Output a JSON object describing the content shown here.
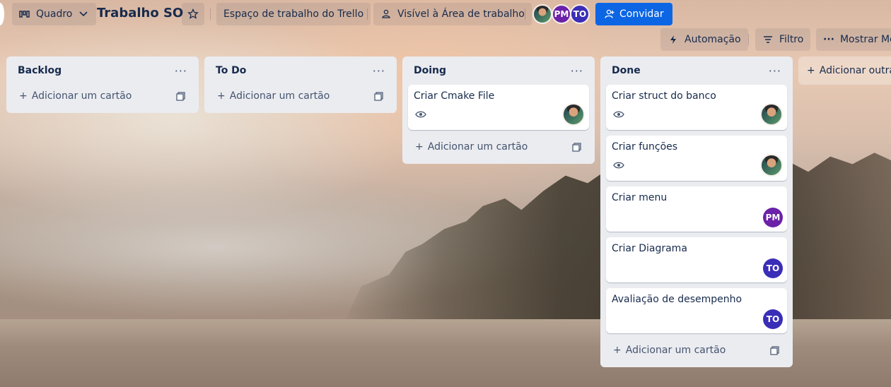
{
  "header": {
    "view_label": "Quadro",
    "board_title": "Trabalho SO",
    "workspace_label": "Espaço de trabalho do Trello",
    "visibility_label": "Visível à Área de trabalho",
    "invite_label": "Convidar",
    "members": [
      {
        "initials": "",
        "color": "photo"
      },
      {
        "initials": "PM",
        "color": "#6b21a8"
      },
      {
        "initials": "TO",
        "color": "#3a2db7"
      }
    ]
  },
  "toolbar": {
    "automation_label": "Automação",
    "filter_label": "Filtro",
    "show_menu_label": "Mostrar Me"
  },
  "lists": [
    {
      "title": "Backlog",
      "cards": [],
      "add_label": "Adicionar um cartão"
    },
    {
      "title": "To Do",
      "cards": [],
      "add_label": "Adicionar um cartão"
    },
    {
      "title": "Doing",
      "add_label": "Adicionar um cartão",
      "cards": [
        {
          "title": "Criar Cmake File",
          "watching": true,
          "member": "photo"
        }
      ]
    },
    {
      "title": "Done",
      "add_label": "Adicionar um cartão",
      "cards": [
        {
          "title": "Criar struct do banco",
          "watching": true,
          "member": "photo"
        },
        {
          "title": "Criar funções",
          "watching": true,
          "member": "photo"
        },
        {
          "title": "Criar menu",
          "watching": false,
          "member": "PM"
        },
        {
          "title": "Criar Diagrama",
          "watching": false,
          "member": "TO"
        },
        {
          "title": "Avaliação de desempenho",
          "watching": false,
          "member": "TO"
        }
      ]
    }
  ],
  "add_list_label": "Adicionar outra lista",
  "colors": {
    "accent": "#0c66e4",
    "pm": "#6b21a8",
    "to": "#3a2db7"
  }
}
